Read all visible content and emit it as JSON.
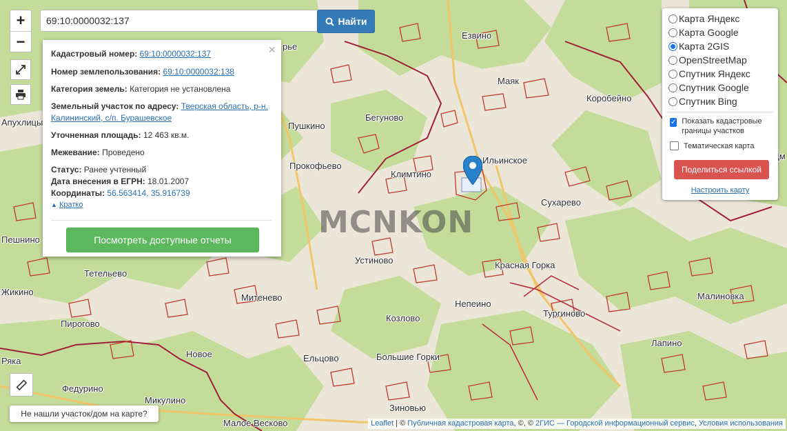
{
  "map": {
    "watermark": "MCNKON",
    "places": [
      {
        "name": "Езвино"
      },
      {
        "name": "Маяк"
      },
      {
        "name": "Коробейно"
      },
      {
        "name": "Бегуново"
      },
      {
        "name": "Пушкино"
      },
      {
        "name": "Прокофьево"
      },
      {
        "name": "Климтино"
      },
      {
        "name": "Ильинское"
      },
      {
        "name": "Сухарево"
      },
      {
        "name": "Устиново"
      },
      {
        "name": "Красная Горка"
      },
      {
        "name": "Тетельево"
      },
      {
        "name": "Митенево"
      },
      {
        "name": "Непеино"
      },
      {
        "name": "Малиновка"
      },
      {
        "name": "Пирогово"
      },
      {
        "name": "Козлово"
      },
      {
        "name": "Тургиново"
      },
      {
        "name": "Новое"
      },
      {
        "name": "Ельцово"
      },
      {
        "name": "Большие Горки"
      },
      {
        "name": "Лапино"
      },
      {
        "name": "Федурино"
      },
      {
        "name": "Микулино"
      },
      {
        "name": "Зиновью"
      },
      {
        "name": "Малое Весково"
      },
      {
        "name": "Апухлицы"
      },
      {
        "name": "Пешнино"
      },
      {
        "name": "Жикино"
      },
      {
        "name": "рье"
      },
      {
        "name": "Дм"
      },
      {
        "name": "Ряка"
      }
    ]
  },
  "controls": {
    "zoom_in": "+",
    "zoom_out": "−",
    "fullscreen_icon": "expand-icon",
    "print_icon": "printer-icon",
    "ruler_icon": "ruler-icon"
  },
  "search": {
    "value": "69:10:0000032:137",
    "button_label": "Найти"
  },
  "popup": {
    "close": "×",
    "cadastral_label": "Кадастровый номер:",
    "cadastral_value": "69:10:0000032:137",
    "land_use_label": "Номер землепользования:",
    "land_use_value": "69:10:0000032:138",
    "category_label": "Категория земель:",
    "category_value": "Категория не установлена",
    "address_label": "Земельный участок по адресу:",
    "address_value": "Тверская область, р-н. Калининский, с/п. Бурашевское",
    "area_label": "Уточненная площадь:",
    "area_value": "12 463 кв.м.",
    "survey_label": "Межевание:",
    "survey_value": "Проведено",
    "status_label": "Статус:",
    "status_value": "Ранее учтенный",
    "egrn_label": "Дата внесения в ЕГРН:",
    "egrn_value": "18.01.2007",
    "coords_label": "Координаты:",
    "coords_value": "56.563414, 35.916739",
    "brief_link": "Кратко",
    "reports_button": "Посмотреть доступные отчеты"
  },
  "layers": {
    "base_maps": [
      {
        "label": "Карта Яндекс",
        "selected": false
      },
      {
        "label": "Карта Google",
        "selected": false
      },
      {
        "label": "Карта 2GIS",
        "selected": true
      },
      {
        "label": "OpenStreetMap",
        "selected": false
      },
      {
        "label": "Спутник Яндекс",
        "selected": false
      },
      {
        "label": "Спутник Google",
        "selected": false
      },
      {
        "label": "Спутник Bing",
        "selected": false
      }
    ],
    "show_cadastral_label": "Показать кадастровые границы участков",
    "show_cadastral_checked": true,
    "thematic_label": "Тематическая карта",
    "thematic_checked": false,
    "share_button": "Поделиться ссылкой",
    "configure_link": "Настроить карту"
  },
  "not_found_button": "Не нашли участок/дом на карте?",
  "attribution": {
    "leaflet": "Leaflet",
    "sep1": " | © ",
    "pkk": "Публичная кадастровая карта",
    "sep2": ", ©, © ",
    "gis": "2ГИС — Городской информационный сервис",
    "sep3": ", ",
    "terms": "Условия использования"
  },
  "colors": {
    "forest": "#c3dc9a",
    "field": "#ece6d8",
    "parcel_border": "#c0392b",
    "region_border": "#a0203a",
    "road": "#f1c56a",
    "accent_blue": "#337ab7",
    "green_button": "#5cb85c",
    "red_button": "#d9534f"
  }
}
